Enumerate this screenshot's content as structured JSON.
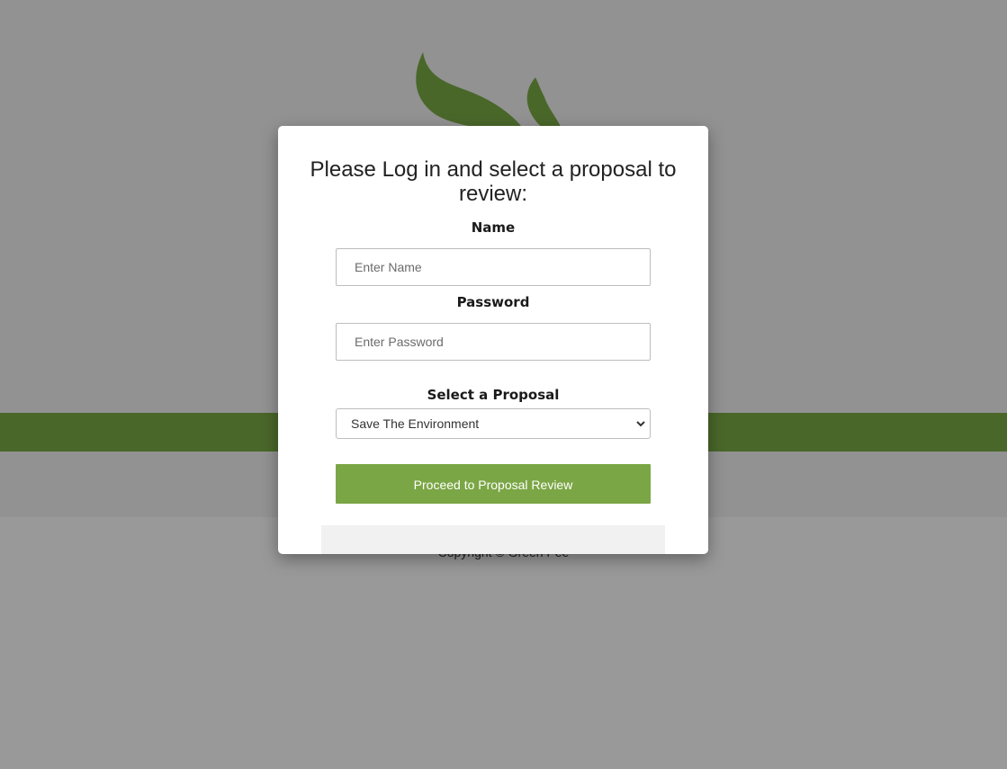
{
  "background": {
    "copyright": "Copyright © Green Pee",
    "logo_icon": "leaf-logo-icon",
    "colors": {
      "band": "#4a672a",
      "overlay": "#929292"
    }
  },
  "login": {
    "title": "Please Log in and select a proposal to review:",
    "name_label": "Name",
    "name_placeholder": "Enter Name",
    "password_label": "Password",
    "password_placeholder": "Enter Password",
    "proposal_label": "Select a Proposal",
    "proposal_selected": "Save The Environment",
    "proceed_label": "Proceed to Proposal Review",
    "colors": {
      "button": "#7ba645"
    }
  }
}
